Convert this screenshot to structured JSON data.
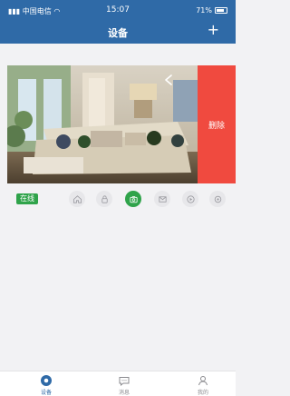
{
  "status_bar": {
    "carrier": "中国电信",
    "time": "15:07",
    "battery": "71%",
    "battery_level": 0.71
  },
  "header": {
    "title": "设备",
    "add_label": "+"
  },
  "device": {
    "delete_label": "删除",
    "status": "在线"
  },
  "actions": [
    {
      "name": "home-icon"
    },
    {
      "name": "lock-icon"
    },
    {
      "name": "camera-icon",
      "active": true
    },
    {
      "name": "mail-icon"
    },
    {
      "name": "play-icon"
    },
    {
      "name": "settings-icon"
    }
  ],
  "tabs": [
    {
      "label": "设备",
      "icon": "device-icon",
      "active": true
    },
    {
      "label": "消息",
      "icon": "message-icon",
      "active": false
    },
    {
      "label": "我的",
      "icon": "user-icon",
      "active": false
    }
  ],
  "colors": {
    "header": "#2f6aa7",
    "delete": "#f04a3f",
    "online": "#2fa34a"
  }
}
